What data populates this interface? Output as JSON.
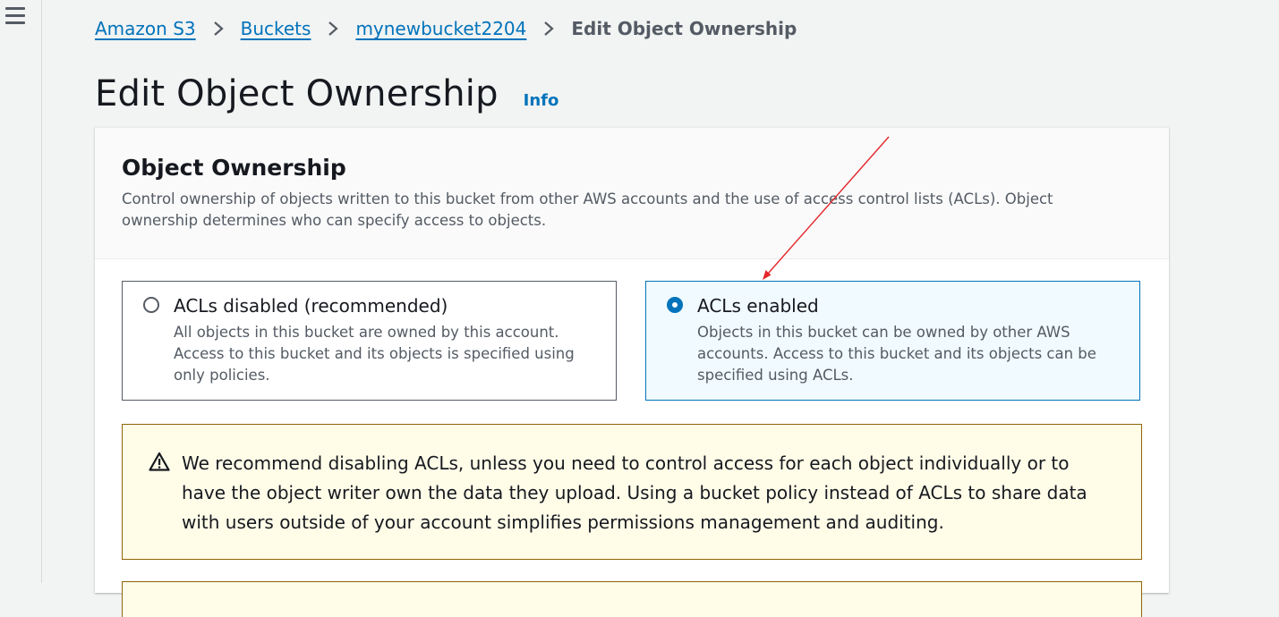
{
  "nav": {
    "menu_icon": "hamburger-menu-icon"
  },
  "breadcrumb": {
    "items": [
      "Amazon S3",
      "Buckets",
      "mynewbucket2204"
    ],
    "current": "Edit Object Ownership",
    "separator_icon": "chevron-right-icon"
  },
  "header": {
    "title": "Edit Object Ownership",
    "info_label": "Info"
  },
  "panel": {
    "title": "Object Ownership",
    "description": "Control ownership of objects written to this bucket from other AWS accounts and the use of access control lists (ACLs). Object ownership determines who can specify access to objects.",
    "options": [
      {
        "label": "ACLs disabled (recommended)",
        "description": "All objects in this bucket are owned by this account. Access to this bucket and its objects is specified using only policies.",
        "selected": false
      },
      {
        "label": "ACLs enabled",
        "description": "Objects in this bucket can be owned by other AWS accounts. Access to this bucket and its objects can be specified using ACLs.",
        "selected": true
      }
    ],
    "warning": {
      "icon": "warning-icon",
      "text": "We recommend disabling ACLs, unless you need to control access for each object individually or to have the object writer own the data they upload. Using a bucket policy instead of ACLs to share data with users outside of your account simplifies permissions management and auditing."
    }
  },
  "colors": {
    "link": "#0073bb",
    "selected_border": "#0073bb",
    "selected_bg": "#f1faff",
    "warning_bg": "#fffce8",
    "warning_border": "#8d6605",
    "annotation_arrow": "#e3262b"
  }
}
